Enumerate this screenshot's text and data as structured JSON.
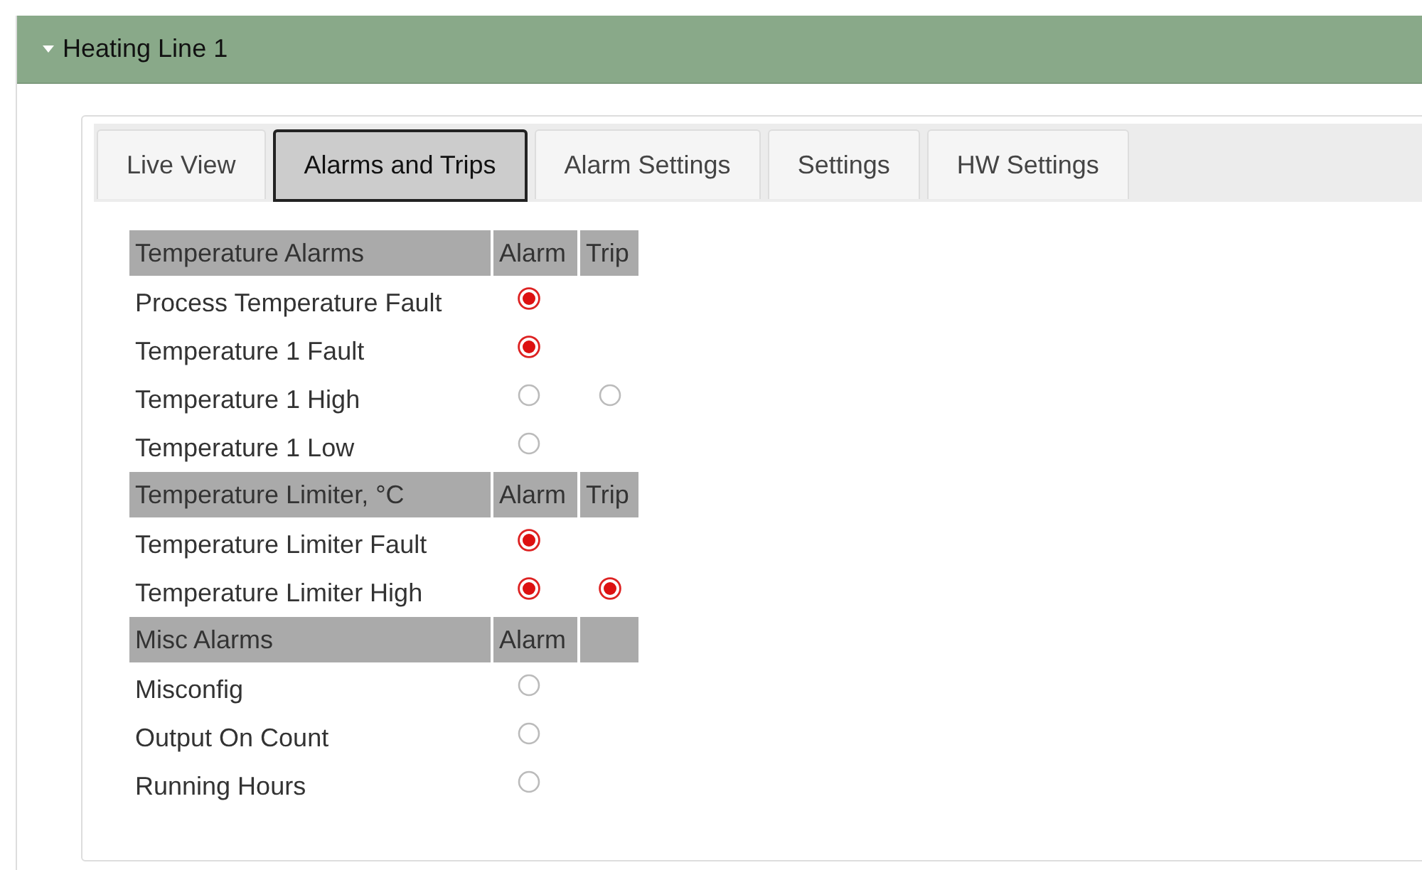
{
  "panel": {
    "title": "Heating Line 1",
    "expanded": true
  },
  "tabs": [
    {
      "label": "Live View",
      "selected": false
    },
    {
      "label": "Alarms and Trips",
      "selected": true
    },
    {
      "label": "Alarm Settings",
      "selected": false
    },
    {
      "label": "Settings",
      "selected": false
    },
    {
      "label": "HW Settings",
      "selected": false
    }
  ],
  "sections": [
    {
      "title": "Temperature Alarms",
      "columns": [
        "Alarm",
        "Trip"
      ],
      "rows": [
        {
          "label": "Process Temperature Fault",
          "alarm": {
            "on": true
          }
        },
        {
          "label": "Temperature 1 Fault",
          "alarm": {
            "on": true
          }
        },
        {
          "label": "Temperature 1 High",
          "alarm": {
            "on": false
          },
          "trip": {
            "on": false
          }
        },
        {
          "label": "Temperature 1 Low",
          "alarm": {
            "on": false
          }
        }
      ]
    },
    {
      "title": "Temperature Limiter, °C",
      "columns": [
        "Alarm",
        "Trip"
      ],
      "rows": [
        {
          "label": "Temperature Limiter Fault",
          "alarm": {
            "on": true
          }
        },
        {
          "label": "Temperature Limiter High",
          "alarm": {
            "on": true
          },
          "trip": {
            "on": true
          }
        }
      ]
    },
    {
      "title": "Misc Alarms",
      "columns": [
        "Alarm"
      ],
      "rows": [
        {
          "label": "Misconfig",
          "alarm": {
            "on": false
          }
        },
        {
          "label": "Output On Count",
          "alarm": {
            "on": false
          }
        },
        {
          "label": "Running Hours",
          "alarm": {
            "on": false
          }
        }
      ]
    }
  ]
}
